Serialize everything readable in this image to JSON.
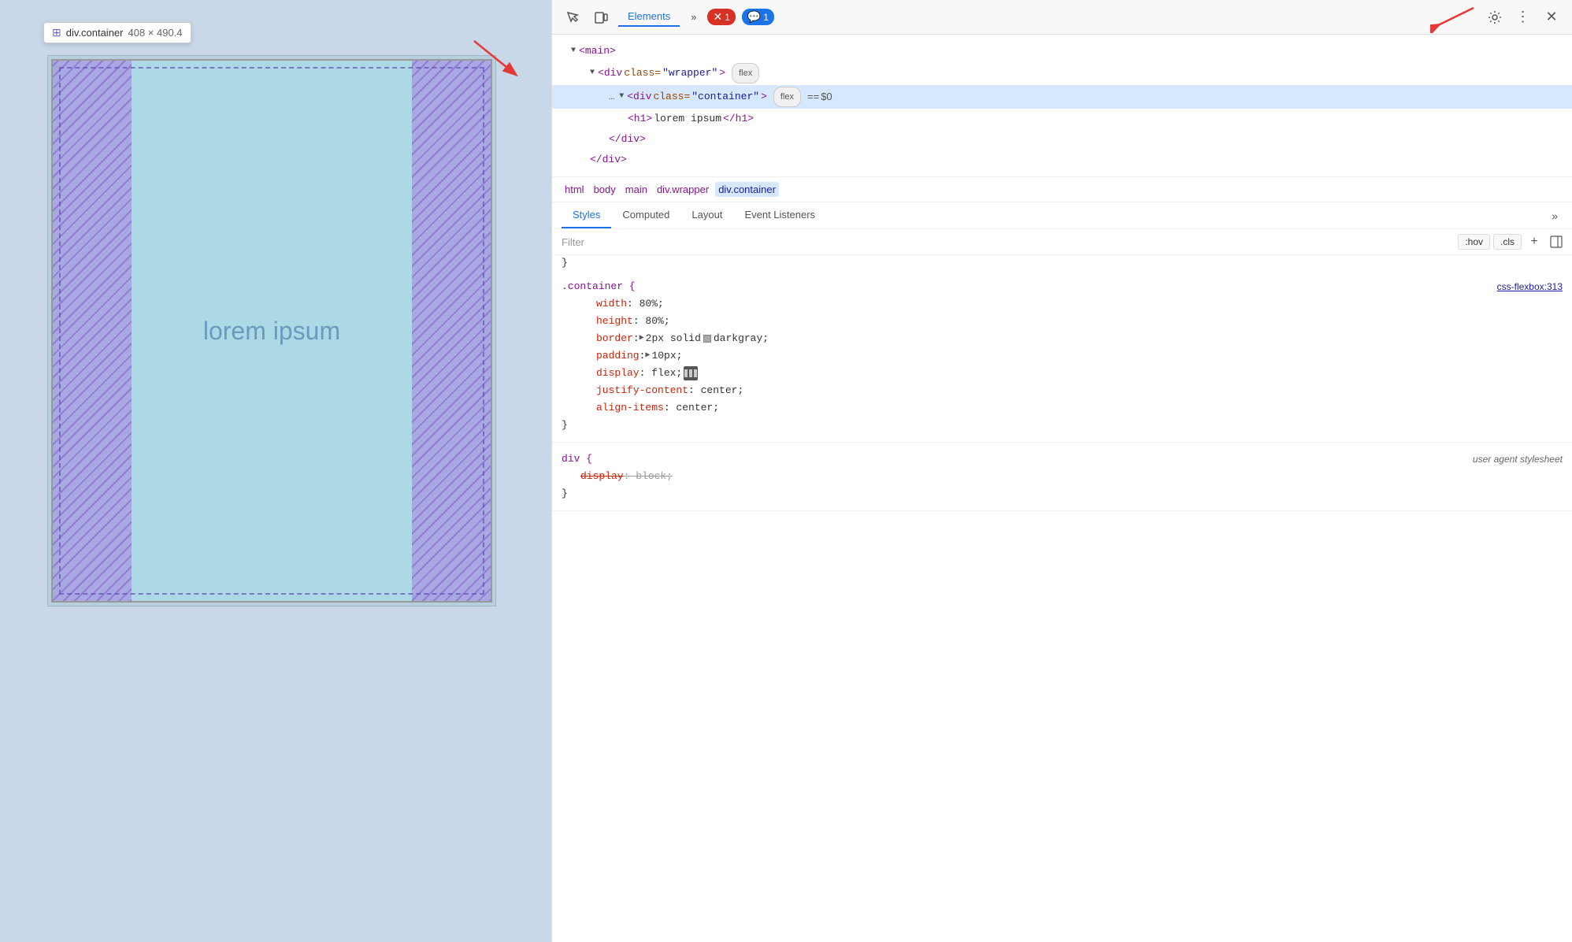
{
  "viewport": {
    "tooltip": {
      "element": "div.container",
      "size": "408 × 490.4"
    },
    "demo_text": "lorem ipsum"
  },
  "devtools": {
    "toolbar": {
      "tabs": [
        "Elements"
      ],
      "more_label": "»",
      "error_count": "1",
      "message_count": "1"
    },
    "dom_tree": {
      "lines": [
        {
          "indent": 1,
          "content": "<main>"
        },
        {
          "indent": 2,
          "content": "<div class=\"wrapper\">",
          "badge": "flex"
        },
        {
          "indent": 3,
          "content": "<div class=\"container\">",
          "badge": "flex",
          "selected": true,
          "extra": "== $0"
        },
        {
          "indent": 4,
          "content": "<h1>lorem ipsum</h1>"
        },
        {
          "indent": 3,
          "content": "</div>"
        },
        {
          "indent": 2,
          "content": "</div>"
        }
      ]
    },
    "breadcrumb": [
      "html",
      "body",
      "main",
      "div.wrapper",
      "div.container"
    ],
    "sub_tabs": [
      "Styles",
      "Computed",
      "Layout",
      "Event Listeners",
      "»"
    ],
    "filter": {
      "placeholder": "Filter",
      "hov_label": ":hov",
      "cls_label": ".cls"
    },
    "css_rules": [
      {
        "selector": ".container {",
        "source": "css-flexbox:313",
        "source_type": "link",
        "properties": [
          {
            "prop": "width",
            "value": "80%",
            "strikethrough": false
          },
          {
            "prop": "height",
            "value": "80%",
            "strikethrough": false
          },
          {
            "prop": "border",
            "value": "2px solid",
            "color": "darkgray",
            "has_color": true,
            "has_triangle": true,
            "strikethrough": false
          },
          {
            "prop": "padding",
            "value": "10px",
            "has_triangle": true,
            "strikethrough": false
          },
          {
            "prop": "display",
            "value": "flex",
            "has_flexicon": true,
            "strikethrough": false
          },
          {
            "prop": "justify-content",
            "value": "center",
            "strikethrough": false
          },
          {
            "prop": "align-items",
            "value": "center",
            "strikethrough": false
          }
        ],
        "closing": "}"
      },
      {
        "selector": "div {",
        "source": "user agent stylesheet",
        "source_type": "italic",
        "properties": [
          {
            "prop": "display",
            "value": "block",
            "strikethrough": true
          }
        ],
        "closing": "}"
      }
    ]
  }
}
